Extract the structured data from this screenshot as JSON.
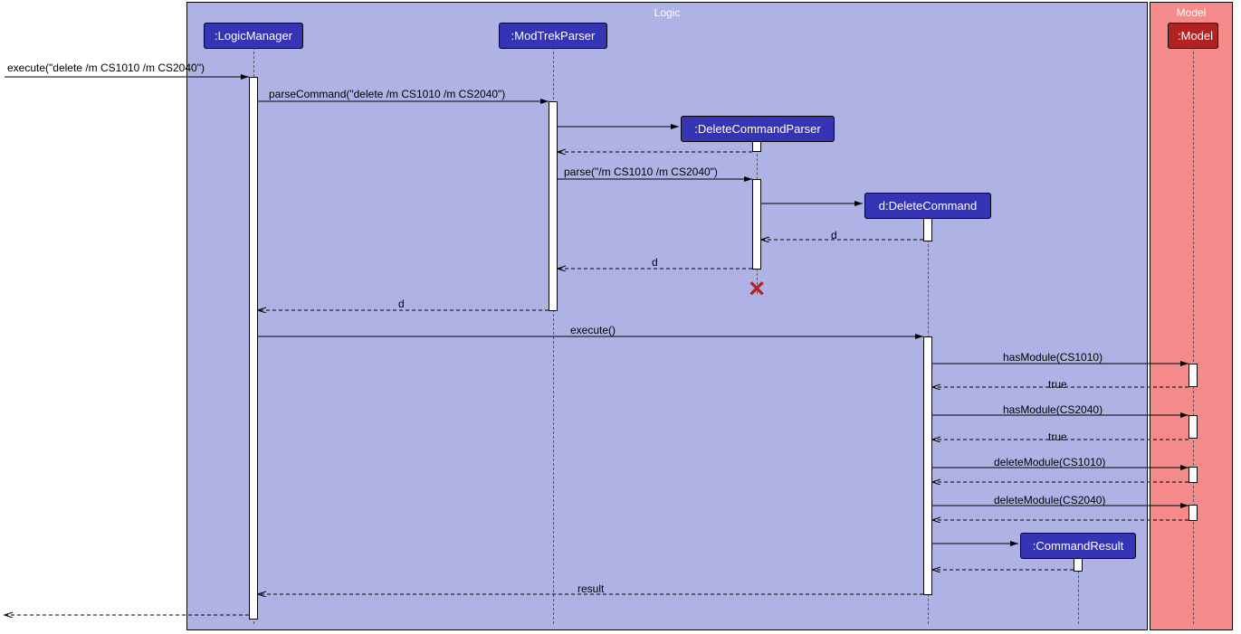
{
  "frames": {
    "logic": {
      "title": "Logic"
    },
    "model": {
      "title": "Model"
    }
  },
  "participants": {
    "logicManager": {
      "label": ":LogicManager"
    },
    "modTrekParser": {
      "label": ":ModTrekParser"
    },
    "deleteCommandParser": {
      "label": ":DeleteCommandParser"
    },
    "deleteCommand": {
      "label": "d:DeleteCommand"
    },
    "commandResult": {
      "label": ":CommandResult"
    },
    "model": {
      "label": ":Model"
    }
  },
  "messages": {
    "m1": "execute(\"delete /m CS1010 /m CS2040\")",
    "m2": "parseCommand(\"delete /m CS1010 /m CS2040\")",
    "m3": "parse(\"/m CS1010 /m CS2040\")",
    "m4": "d",
    "m5": "d",
    "m6": "d",
    "m7": "execute()",
    "m8": "hasModule(CS1010)",
    "m9": "true",
    "m10": "hasModule(CS2040)",
    "m11": "true",
    "m12": "deleteModule(CS1010)",
    "m13": "deleteModule(CS2040)",
    "m14": "result"
  },
  "chart_data": {
    "type": "sequence-diagram",
    "frames": [
      {
        "name": "Logic",
        "participants": [
          "LogicManager",
          "ModTrekParser",
          "DeleteCommandParser",
          "DeleteCommand",
          "CommandResult"
        ]
      },
      {
        "name": "Model",
        "participants": [
          "Model"
        ]
      }
    ],
    "participants": [
      "LogicManager",
      "ModTrekParser",
      "DeleteCommandParser",
      "DeleteCommand",
      "CommandResult",
      "Model"
    ],
    "events": [
      {
        "from": "actor",
        "to": "LogicManager",
        "label": "execute(\"delete /m CS1010 /m CS2040\")",
        "kind": "sync"
      },
      {
        "from": "LogicManager",
        "to": "ModTrekParser",
        "label": "parseCommand(\"delete /m CS1010 /m CS2040\")",
        "kind": "sync"
      },
      {
        "from": "ModTrekParser",
        "to": "DeleteCommandParser",
        "label": "<<create>>",
        "kind": "create"
      },
      {
        "from": "DeleteCommandParser",
        "to": "ModTrekParser",
        "label": "",
        "kind": "return"
      },
      {
        "from": "ModTrekParser",
        "to": "DeleteCommandParser",
        "label": "parse(\"/m CS1010 /m CS2040\")",
        "kind": "sync"
      },
      {
        "from": "DeleteCommandParser",
        "to": "DeleteCommand",
        "label": "<<create>>",
        "kind": "create"
      },
      {
        "from": "DeleteCommand",
        "to": "DeleteCommandParser",
        "label": "d",
        "kind": "return"
      },
      {
        "from": "DeleteCommandParser",
        "to": "ModTrekParser",
        "label": "d",
        "kind": "return"
      },
      {
        "from": "DeleteCommandParser",
        "to": null,
        "label": "destroy",
        "kind": "destroy"
      },
      {
        "from": "ModTrekParser",
        "to": "LogicManager",
        "label": "d",
        "kind": "return"
      },
      {
        "from": "LogicManager",
        "to": "DeleteCommand",
        "label": "execute()",
        "kind": "sync"
      },
      {
        "from": "DeleteCommand",
        "to": "Model",
        "label": "hasModule(CS1010)",
        "kind": "sync"
      },
      {
        "from": "Model",
        "to": "DeleteCommand",
        "label": "true",
        "kind": "return"
      },
      {
        "from": "DeleteCommand",
        "to": "Model",
        "label": "hasModule(CS2040)",
        "kind": "sync"
      },
      {
        "from": "Model",
        "to": "DeleteCommand",
        "label": "true",
        "kind": "return"
      },
      {
        "from": "DeleteCommand",
        "to": "Model",
        "label": "deleteModule(CS1010)",
        "kind": "sync"
      },
      {
        "from": "Model",
        "to": "DeleteCommand",
        "label": "",
        "kind": "return"
      },
      {
        "from": "DeleteCommand",
        "to": "Model",
        "label": "deleteModule(CS2040)",
        "kind": "sync"
      },
      {
        "from": "Model",
        "to": "DeleteCommand",
        "label": "",
        "kind": "return"
      },
      {
        "from": "DeleteCommand",
        "to": "CommandResult",
        "label": "<<create>>",
        "kind": "create"
      },
      {
        "from": "CommandResult",
        "to": "DeleteCommand",
        "label": "",
        "kind": "return"
      },
      {
        "from": "DeleteCommand",
        "to": "LogicManager",
        "label": "result",
        "kind": "return"
      },
      {
        "from": "LogicManager",
        "to": "actor",
        "label": "",
        "kind": "return"
      }
    ]
  }
}
